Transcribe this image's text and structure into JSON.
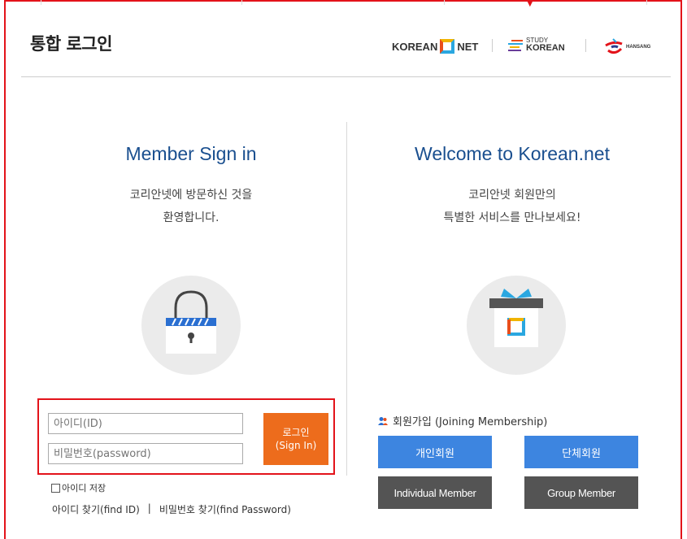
{
  "header": {
    "title": "통합 로그인",
    "logos": {
      "korean_net_left": "KOREAN",
      "korean_net_right": "NET",
      "study_small": "STUDY",
      "study_big": "KOREAN",
      "hansang": "HANSANG"
    }
  },
  "signin": {
    "title": "Member Sign in",
    "desc_line1": "코리안넷에 방문하신 것을",
    "desc_line2": "환영합니다.",
    "icon": "lock-icon",
    "id_placeholder": "아이디(ID)",
    "pw_placeholder": "비밀번호(password)",
    "login_label_ko": "로그인",
    "login_label_en": "(Sign In)",
    "save_id": "아이디 저장",
    "find_id": "아이디 찾기(find ID)",
    "sep": "|",
    "find_pw": "비밀번호 찾기(find Password)"
  },
  "welcome": {
    "title": "Welcome to Korean.net",
    "desc_line1": "코리안넷 회원만의",
    "desc_line2": "특별한 서비스를 만나보세요!",
    "icon": "gift-icon",
    "join_label": "회원가입 (Joining Membership)",
    "individual_ko": "개인회원",
    "group_ko": "단체회원",
    "individual_en": "Individual Member",
    "group_en": "Group Member"
  },
  "colors": {
    "accent_red": "#e3131a",
    "title_blue": "#1a4f8f",
    "button_orange": "#ed6c1c",
    "button_blue": "#3d85e0",
    "button_gray": "#545454"
  }
}
